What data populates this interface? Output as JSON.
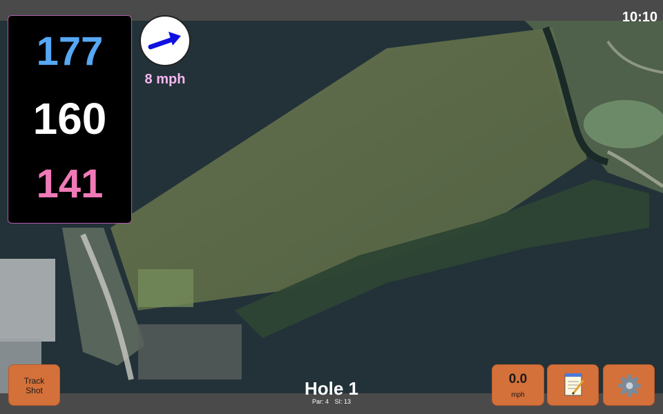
{
  "status": {
    "time": "10:10"
  },
  "distances": {
    "back": "177",
    "middle": "160",
    "front": "141"
  },
  "wind": {
    "speed_label": "8 mph",
    "icon": "wind-direction-arrow-icon",
    "arrow_color": "#1010e0"
  },
  "hole": {
    "title": "Hole 1",
    "par_label": "Par: 4",
    "si_label": "SI: 13"
  },
  "buttons": {
    "track_shot_line1": "Track",
    "track_shot_line2": "Shot",
    "speed_value": "0.0",
    "speed_unit": "mph",
    "notes_icon": "notepad-icon",
    "settings_icon": "gear-icon"
  },
  "colors": {
    "back_distance": "#56a8f5",
    "middle_distance": "#ffffff",
    "front_distance": "#f07ab8",
    "button_accent": "#d4703a",
    "border_accent": "#b05ab0"
  }
}
